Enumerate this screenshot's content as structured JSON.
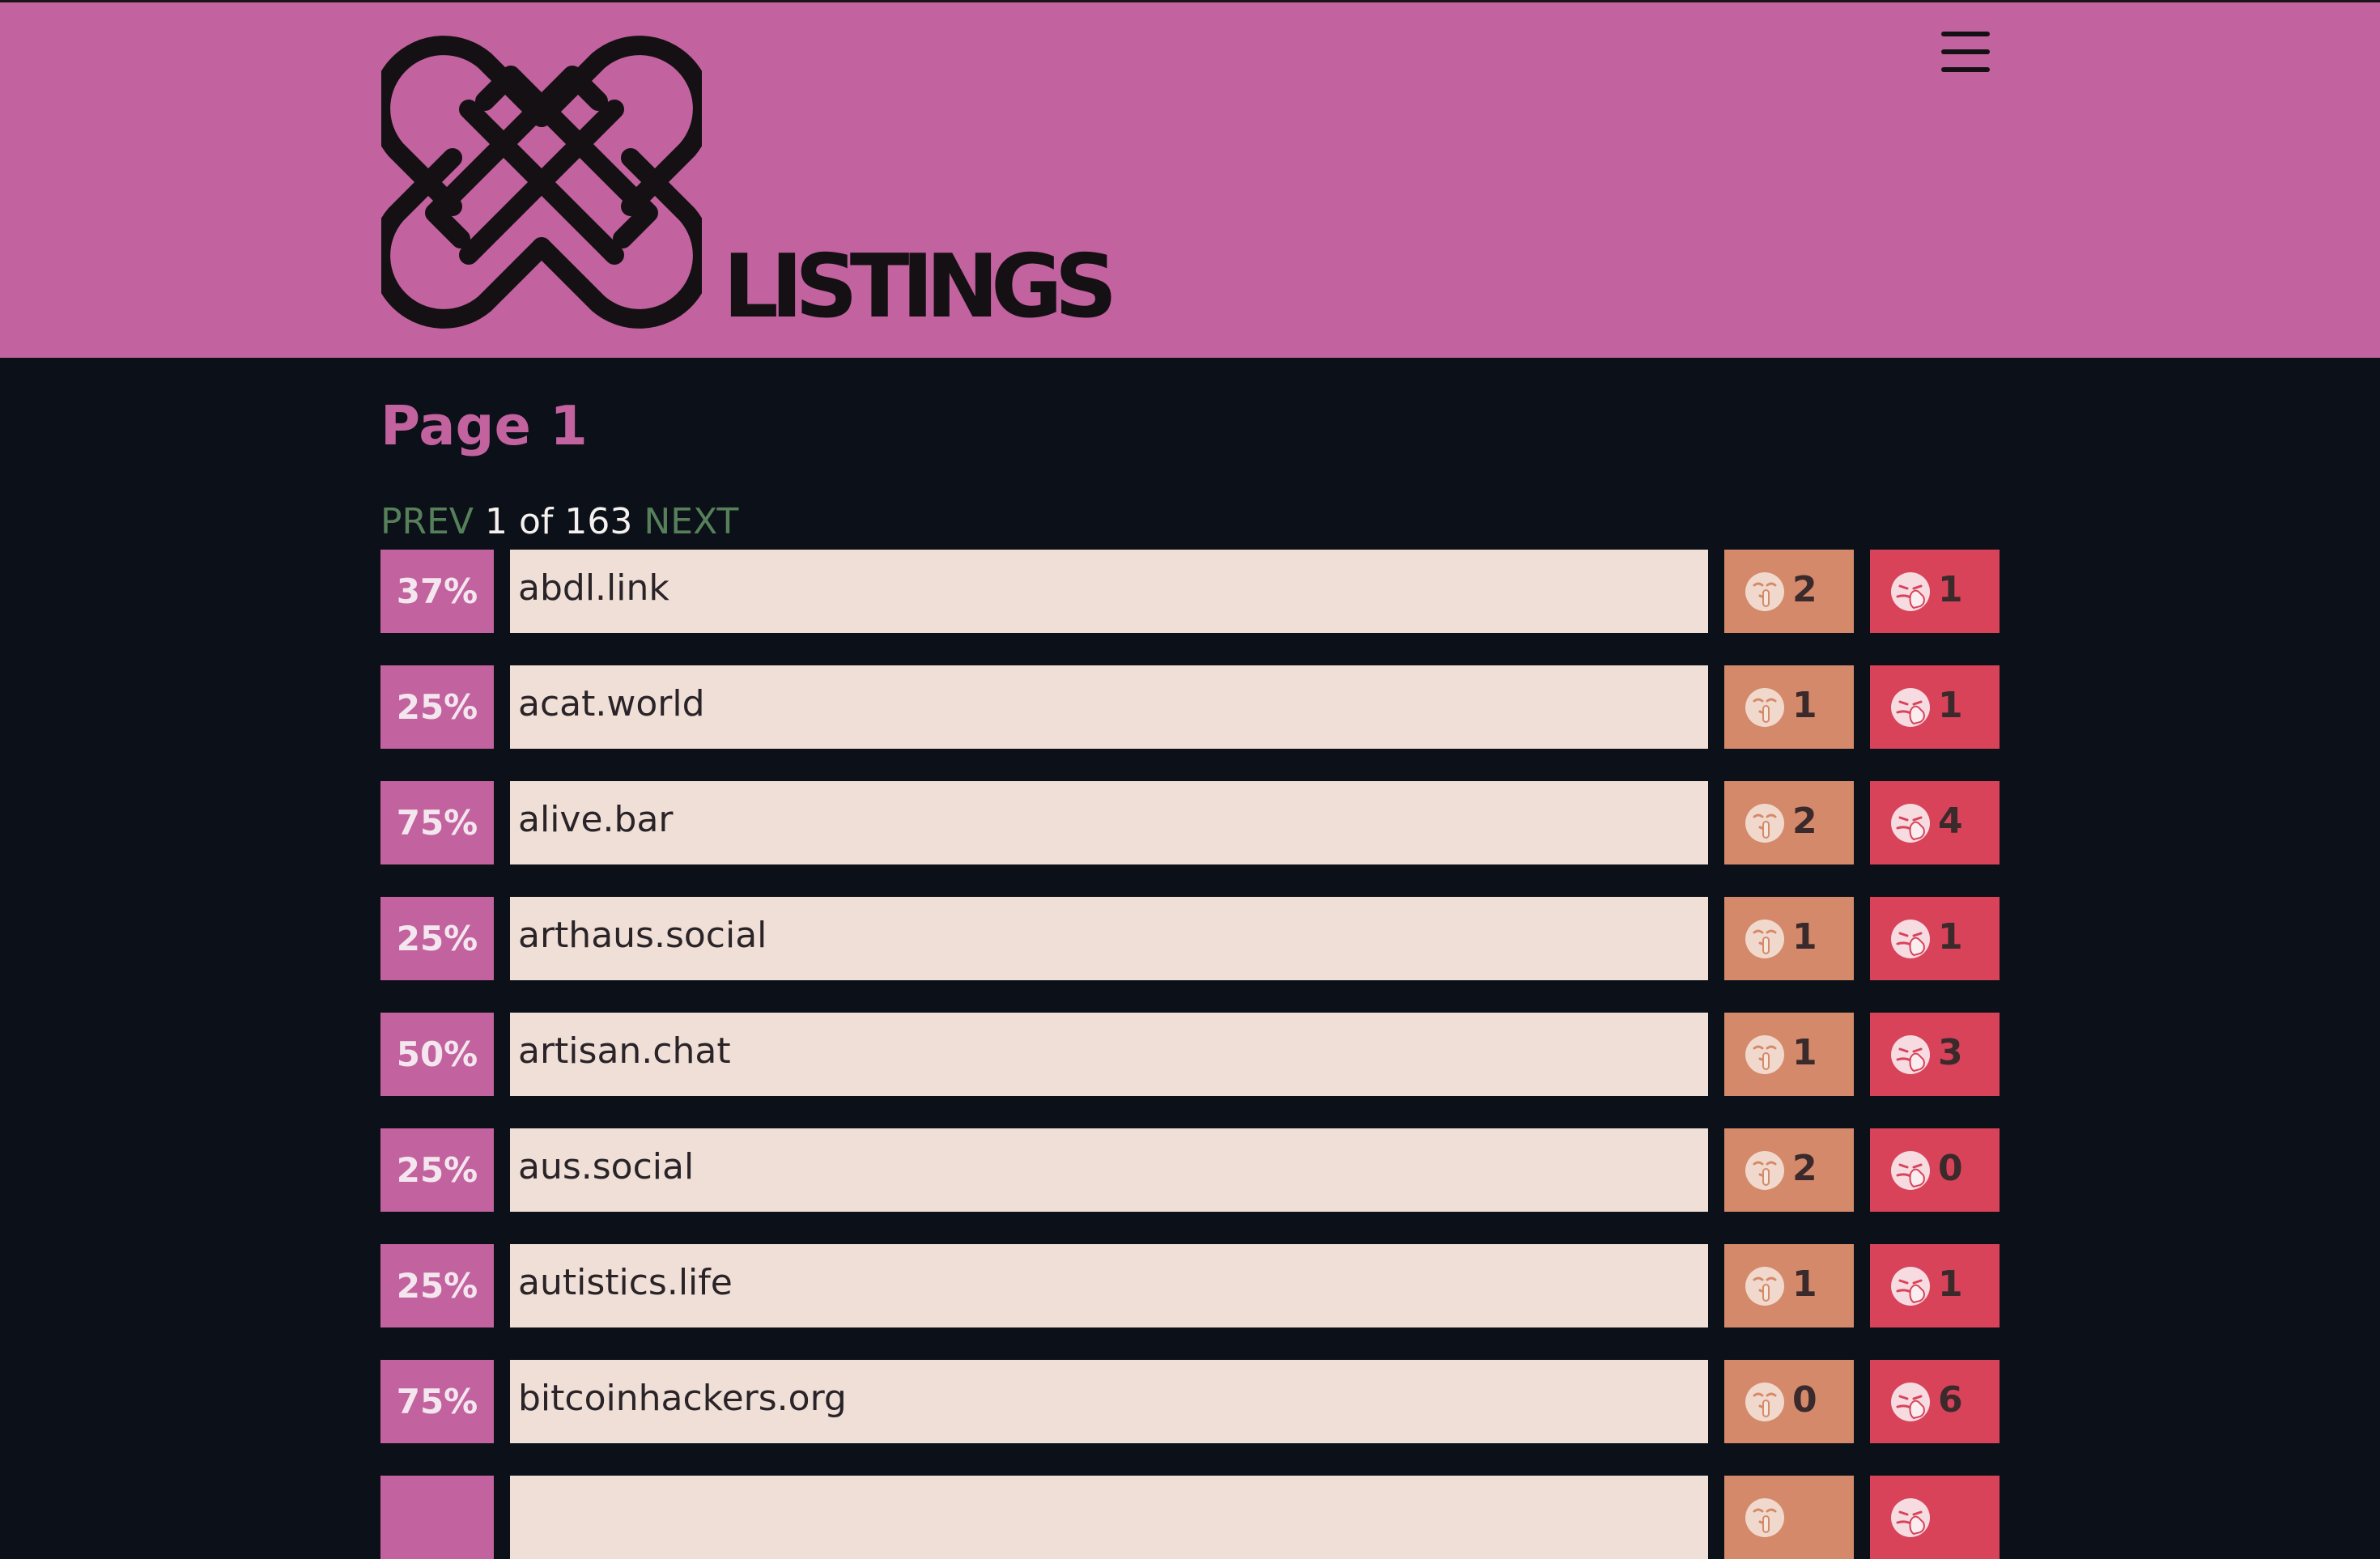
{
  "header": {
    "brand": "LISTINGS",
    "logo_icon": "interlaced-knot-logo",
    "menu_icon": "hamburger-menu-icon",
    "background_color": "#c2629e"
  },
  "page_title": "Page 1",
  "pager": {
    "prev": "PREV",
    "position": "1 of 163",
    "next": "NEXT"
  },
  "colors": {
    "percent_badge": "#c2629e",
    "silence_badge": "#d5896b",
    "block_badge": "#d8435a",
    "domain_field": "#efdfd7",
    "pager_link": "#56805a",
    "page_background": "#0c1018"
  },
  "icons": {
    "silence": "shushing-face-icon",
    "block": "face-with-hand-over-mouth-icon"
  },
  "rows": [
    {
      "percent": "37%",
      "domain": "abdl.link",
      "silence": "2",
      "block": "1"
    },
    {
      "percent": "25%",
      "domain": "acat.world",
      "silence": "1",
      "block": "1"
    },
    {
      "percent": "75%",
      "domain": "alive.bar",
      "silence": "2",
      "block": "4"
    },
    {
      "percent": "25%",
      "domain": "arthaus.social",
      "silence": "1",
      "block": "1"
    },
    {
      "percent": "50%",
      "domain": "artisan.chat",
      "silence": "1",
      "block": "3"
    },
    {
      "percent": "25%",
      "domain": "aus.social",
      "silence": "2",
      "block": "0"
    },
    {
      "percent": "25%",
      "domain": "autistics.life",
      "silence": "1",
      "block": "1"
    },
    {
      "percent": "75%",
      "domain": "bitcoinhackers.org",
      "silence": "0",
      "block": "6"
    },
    {
      "percent": "",
      "domain": "",
      "silence": "",
      "block": ""
    }
  ]
}
